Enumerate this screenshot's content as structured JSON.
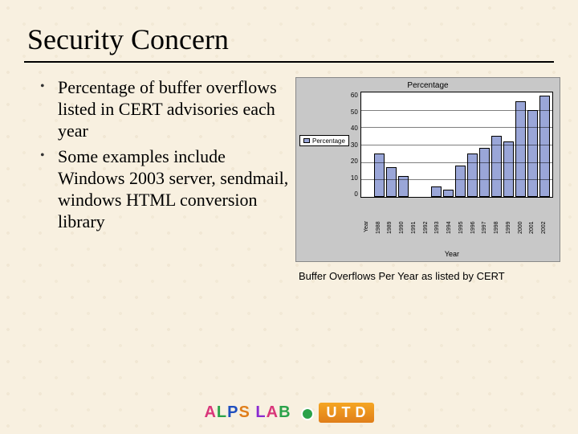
{
  "title": "Security Concern",
  "bullets": [
    "Percentage of buffer overflows listed in CERT advisories each year",
    "Some examples include Windows 2003 server, sendmail, windows HTML conversion library"
  ],
  "chart_caption": "Buffer Overflows Per Year as listed by CERT",
  "chart_data": {
    "type": "bar",
    "title": "Percentage",
    "xlabel": "Year",
    "ylabel": "",
    "ylim": [
      0,
      60
    ],
    "yticks": [
      60,
      50,
      40,
      30,
      20,
      10,
      0
    ],
    "categories": [
      "Year",
      "1988",
      "1989",
      "1990",
      "1991",
      "1992",
      "1993",
      "1994",
      "1995",
      "1996",
      "1997",
      "1998",
      "1999",
      "2000",
      "2001",
      "2002"
    ],
    "series": [
      {
        "name": "Percentage",
        "values": [
          0,
          25,
          17,
          12,
          0,
          0,
          6,
          4,
          18,
          25,
          28,
          35,
          32,
          55,
          50,
          58
        ]
      }
    ],
    "legend": [
      "Percentage"
    ]
  },
  "footer": {
    "alps": "ALPS LAB",
    "utd": "UTD"
  }
}
